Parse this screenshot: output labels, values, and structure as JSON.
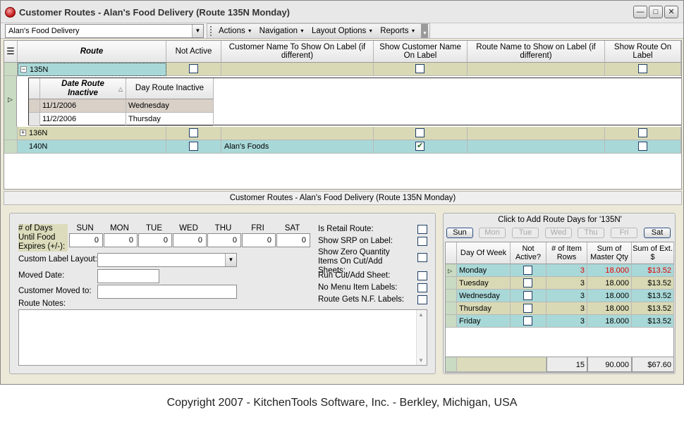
{
  "window": {
    "title": "Customer Routes - Alan's Food Delivery (Route 135N  Monday)"
  },
  "toolbar": {
    "company": "Alan's Food Delivery",
    "menus": [
      "Actions",
      "Navigation",
      "Layout Options",
      "Reports"
    ]
  },
  "grid": {
    "headers": {
      "route": "Route",
      "not_active": "Not Active",
      "cust_name_label": "Customer Name To Show On Label (if different)",
      "show_cust_name": "Show Customer Name On Label",
      "route_name_label": "Route Name to Show on Label (if different)",
      "show_route": "Show Route On Label"
    },
    "rows": [
      {
        "route": "135N",
        "not_active": false,
        "cust_name_label": "",
        "show_cust_name": false,
        "route_name_label": "",
        "show_route": false,
        "expanded": true
      },
      {
        "route": "136N",
        "not_active": false,
        "cust_name_label": "",
        "show_cust_name": false,
        "route_name_label": "",
        "show_route": false,
        "expanded": false
      },
      {
        "route": "140N",
        "not_active": false,
        "cust_name_label": "Alan's Foods",
        "show_cust_name": true,
        "route_name_label": "",
        "show_route": false,
        "expanded": false
      }
    ],
    "detail": {
      "headers": {
        "date_inactive": "Date Route Inactive",
        "day_inactive": "Day Route Inactive"
      },
      "rows": [
        {
          "date": "11/1/2006",
          "day": "Wednesday"
        },
        {
          "date": "11/2/2006",
          "day": "Thursday"
        }
      ]
    }
  },
  "section_title": "Customer Routes - Alan's Food Delivery (Route 135N  Monday)",
  "form": {
    "days_label": "# of Days Until Food Expires (+/-):",
    "day_headers": [
      "SUN",
      "MON",
      "TUE",
      "WED",
      "THU",
      "FRI",
      "SAT"
    ],
    "day_values": [
      "0",
      "0",
      "0",
      "0",
      "0",
      "0",
      "0"
    ],
    "custom_label_layout": "Custom Label Layout:",
    "moved_date": "Moved Date:",
    "customer_moved_to": "Customer Moved to:",
    "route_notes": "Route Notes:",
    "checks": {
      "retail": "Is Retail Route:",
      "srp": "Show SRP on Label:",
      "zero_qty": "Show Zero Quantity Items On Cut/Add Sheets:",
      "run_cut": "Run Cut/Add Sheet:",
      "no_menu": "No Menu Item Labels:",
      "nf_labels": "Route Gets N.F. Labels:"
    }
  },
  "route_days": {
    "title": "Click to Add Route Days for '135N'",
    "buttons": [
      {
        "label": "Sun",
        "on": true
      },
      {
        "label": "Mon",
        "on": false
      },
      {
        "label": "Tue",
        "on": false
      },
      {
        "label": "Wed",
        "on": false
      },
      {
        "label": "Thu",
        "on": false
      },
      {
        "label": "Fri",
        "on": false
      },
      {
        "label": "Sat",
        "on": true
      }
    ],
    "headers": {
      "day": "Day Of Week",
      "not_active": "Not Active?",
      "item_rows": "# of Item Rows",
      "master_qty": "Sum of Master Qty",
      "ext": "Sum of Ext. $"
    },
    "rows": [
      {
        "day": "Monday",
        "item_rows": "3",
        "master_qty": "18.000",
        "ext": "$13.52",
        "highlight": true
      },
      {
        "day": "Tuesday",
        "item_rows": "3",
        "master_qty": "18.000",
        "ext": "$13.52",
        "highlight": false
      },
      {
        "day": "Wednesday",
        "item_rows": "3",
        "master_qty": "18.000",
        "ext": "$13.52",
        "highlight": false
      },
      {
        "day": "Thursday",
        "item_rows": "3",
        "master_qty": "18.000",
        "ext": "$13.52",
        "highlight": false
      },
      {
        "day": "Friday",
        "item_rows": "3",
        "master_qty": "18.000",
        "ext": "$13.52",
        "highlight": false
      }
    ],
    "totals": {
      "item_rows": "15",
      "master_qty": "90.000",
      "ext": "$67.60"
    }
  },
  "footer": {
    "copyright": "Copyright 2007 - KitchenTools Software, Inc. - Berkley, Michigan, USA"
  },
  "colors": {
    "row_teal": "#a9d8d8",
    "row_khaki": "#d9d9b5",
    "selected_outline": "#1a1a1a",
    "negative_red": "#e00000"
  }
}
